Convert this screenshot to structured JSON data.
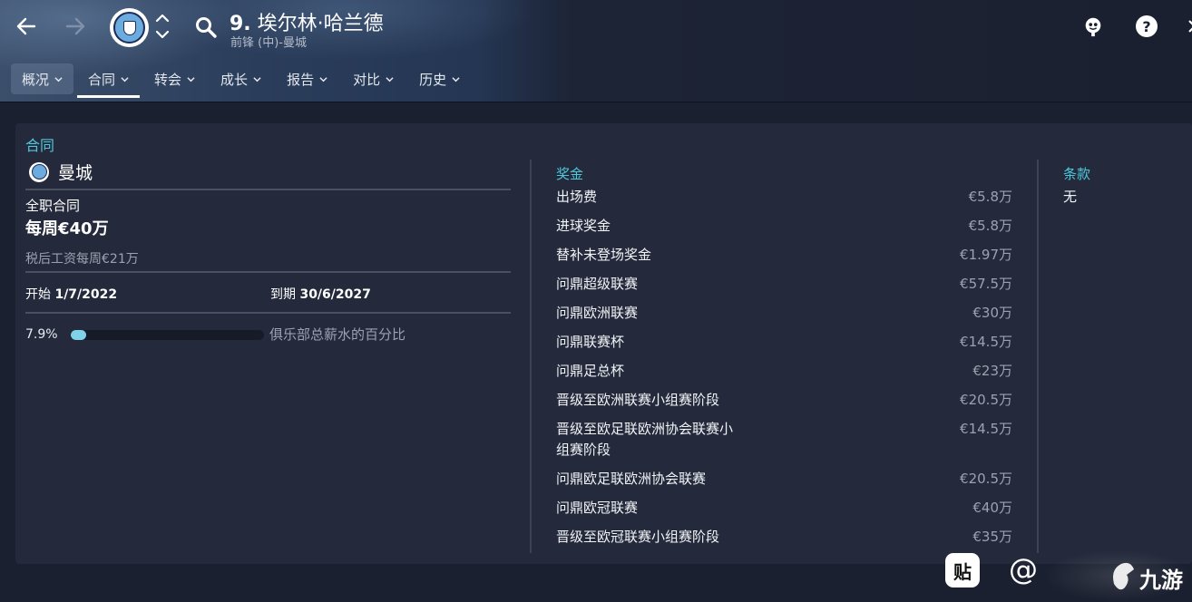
{
  "header": {
    "player_number": "9.",
    "player_name": "埃尔林·哈兰德",
    "subtitle": "前锋 (中)-曼城",
    "club_badge_icon": "manchester-city-crest"
  },
  "tabs": [
    {
      "label": "概况"
    },
    {
      "label": "合同"
    },
    {
      "label": "转会"
    },
    {
      "label": "成长"
    },
    {
      "label": "报告"
    },
    {
      "label": "对比"
    },
    {
      "label": "历史"
    }
  ],
  "active_tab": "合同",
  "contract": {
    "title": "合同",
    "club": "曼城",
    "type": "全职合同",
    "wage": "每周€40万",
    "after_tax": "税后工资每周€21万",
    "start_label": "开始",
    "start_date": "1/7/2022",
    "end_label": "到期",
    "end_date": "30/6/2027",
    "wage_percent_text": "7.9%",
    "wage_percent_value": 0.079,
    "wage_percent_label": "俱乐部总薪水的百分比"
  },
  "bonuses": {
    "title": "奖金",
    "rows": [
      {
        "label": "出场费",
        "value": "€5.8万"
      },
      {
        "label": "进球奖金",
        "value": "€5.8万"
      },
      {
        "label": "替补未登场奖金",
        "value": "€1.97万"
      },
      {
        "label": "问鼎超级联赛",
        "value": "€57.5万"
      },
      {
        "label": "问鼎欧洲联赛",
        "value": "€30万"
      },
      {
        "label": "问鼎联赛杯",
        "value": "€14.5万"
      },
      {
        "label": "问鼎足总杯",
        "value": "€23万"
      },
      {
        "label": "晋级至欧洲联赛小组赛阶段",
        "value": "€20.5万"
      },
      {
        "label": "晋级至欧足联欧洲协会联赛小组赛阶段",
        "value": "€14.5万"
      },
      {
        "label": "问鼎欧足联欧洲协会联赛",
        "value": "€20.5万"
      },
      {
        "label": "问鼎欧冠联赛",
        "value": "€40万"
      },
      {
        "label": "晋级至欧冠联赛小组赛阶段",
        "value": "€35万"
      }
    ]
  },
  "clauses": {
    "title": "条款",
    "value": "无"
  },
  "watermark": {
    "paste_glyph": "贴",
    "at_glyph": "@",
    "site_text": "九游"
  },
  "colors": {
    "accent": "#4fc8dc",
    "bar_fill": "#7fd3e8",
    "panel": "#242a3b",
    "background": "#1b2030"
  }
}
